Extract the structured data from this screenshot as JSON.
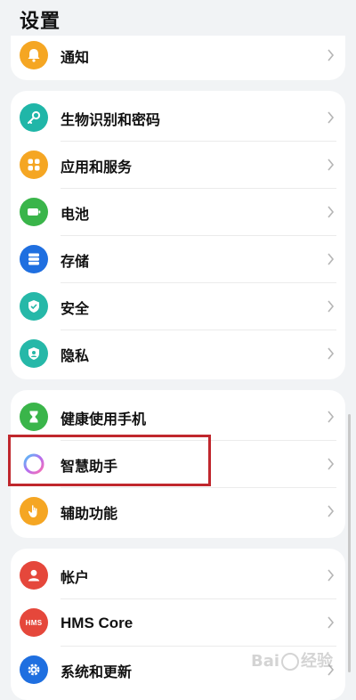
{
  "header": {
    "title": "设置"
  },
  "groups": [
    {
      "items": [
        {
          "label": "通知",
          "icon": "bell-icon",
          "color": "#f5a623"
        }
      ]
    },
    {
      "items": [
        {
          "label": "生物识别和密码",
          "icon": "key-icon",
          "color": "#20b6a8"
        },
        {
          "label": "应用和服务",
          "icon": "apps-icon",
          "color": "#f5a623"
        },
        {
          "label": "电池",
          "icon": "battery-icon",
          "color": "#3ab54a"
        },
        {
          "label": "存储",
          "icon": "storage-icon",
          "color": "#1f6fe0"
        },
        {
          "label": "安全",
          "icon": "shield-check-icon",
          "color": "#26b8a8"
        },
        {
          "label": "隐私",
          "icon": "privacy-shield-icon",
          "color": "#26b8a8"
        }
      ]
    },
    {
      "items": [
        {
          "label": "健康使用手机",
          "icon": "hourglass-icon",
          "color": "#3ab54a"
        },
        {
          "label": "智慧助手",
          "icon": "assistant-ring-icon",
          "color": "#b36df0"
        },
        {
          "label": "辅助功能",
          "icon": "hand-icon",
          "color": "#f5a623"
        }
      ]
    },
    {
      "items": [
        {
          "label": "帐户",
          "icon": "user-icon",
          "color": "#e5473b"
        },
        {
          "label": "HMS Core",
          "icon": "hms-icon",
          "color": "#e5473b",
          "badge": "HMS"
        },
        {
          "label": "系统和更新",
          "icon": "gear-icon",
          "color": "#1f6fe0"
        }
      ]
    }
  ],
  "watermark": {
    "text_left": "Bai",
    "text_right": "经验"
  }
}
